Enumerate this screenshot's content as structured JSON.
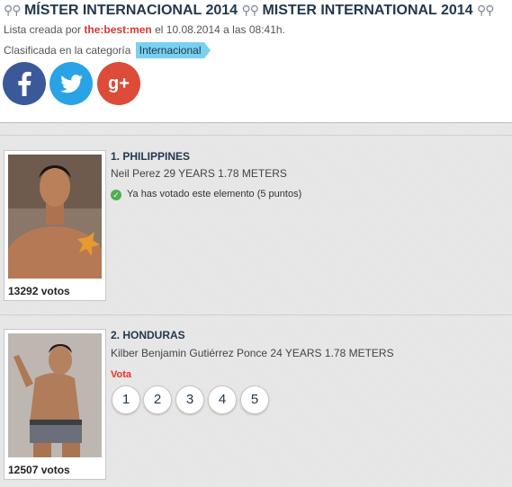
{
  "header": {
    "title_parts": [
      "MÍSTER INTERNACIONAL 2014",
      "MISTER INTERNATIONAL 2014"
    ],
    "title_symbol": "⚲⚲",
    "meta_prefix": "Lista creada por",
    "author": "the:best:men",
    "meta_suffix": "el 10.08.2014 a las 08:41h.",
    "category_prefix": "Clasificada en la categoría",
    "category": "Internacional"
  },
  "share": {
    "facebook_icon": "facebook-icon",
    "twitter_icon": "twitter-icon",
    "googleplus_icon": "google-plus-icon",
    "colors": {
      "facebook": "#3b5998",
      "twitter": "#2aa3e6",
      "googleplus": "#dd4b39"
    }
  },
  "items": [
    {
      "rank_title": "1. PHILIPPINES",
      "description": "Neil Perez 29 YEARS 1.78 METERS",
      "votes": "13292 votos",
      "voted_message": "Ya has votado este elemento (5 puntos)"
    },
    {
      "rank_title": "2. HONDURAS",
      "description": "Kilber Benjamin Gutiérrez Ponce 24 YEARS 1.78 METERS",
      "votes": "12507 votos",
      "vote_label": "Vota",
      "vote_options": [
        "1",
        "2",
        "3",
        "4",
        "5"
      ]
    }
  ]
}
